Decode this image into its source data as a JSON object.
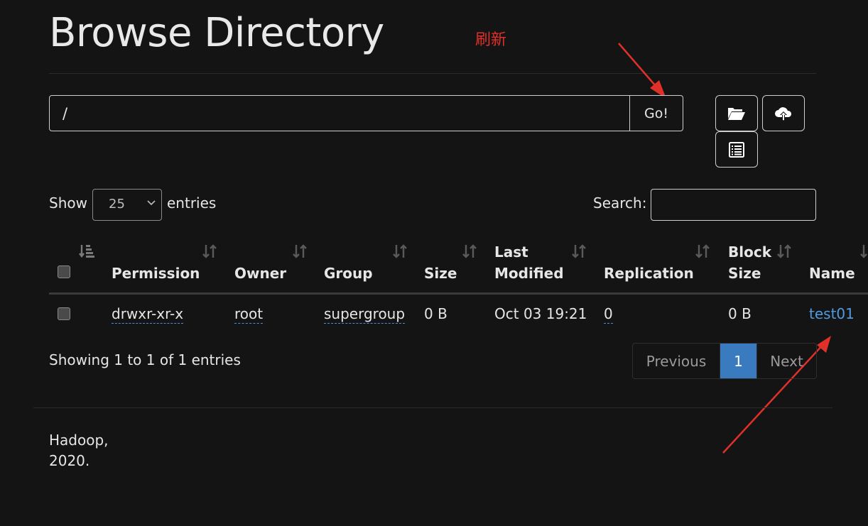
{
  "page": {
    "title": "Browse Directory"
  },
  "annotation": {
    "refresh_text": "刷新"
  },
  "path_bar": {
    "value": "/",
    "go_label": "Go!"
  },
  "toolbar": {
    "icons": [
      "folder-open-icon",
      "cloud-upload-icon",
      "list-icon"
    ]
  },
  "table_controls": {
    "show_label": "Show",
    "entries_value": "25",
    "entries_label": "entries",
    "search_label": "Search:"
  },
  "table": {
    "columns": [
      "Permission",
      "Owner",
      "Group",
      "Size",
      "Last",
      "Modified",
      "Replication",
      "Block",
      "Size",
      "Name"
    ],
    "rows": [
      {
        "permission": "drwxr-xr-x",
        "owner": "root",
        "group": "supergroup",
        "size": "0 B",
        "last_modified": "Oct 03 19:21",
        "replication": "0",
        "block_size": "0 B",
        "name": "test01"
      }
    ]
  },
  "pagination": {
    "info": "Showing 1 to 1 of 1 entries",
    "previous": "Previous",
    "current": "1",
    "next": "Next"
  },
  "footer": {
    "line1": "Hadoop,",
    "line2": "2020."
  },
  "colors": {
    "background": "#141414",
    "link": "#4f9be0",
    "active_page": "#3a7bc0",
    "annotation": "#e0302a"
  }
}
